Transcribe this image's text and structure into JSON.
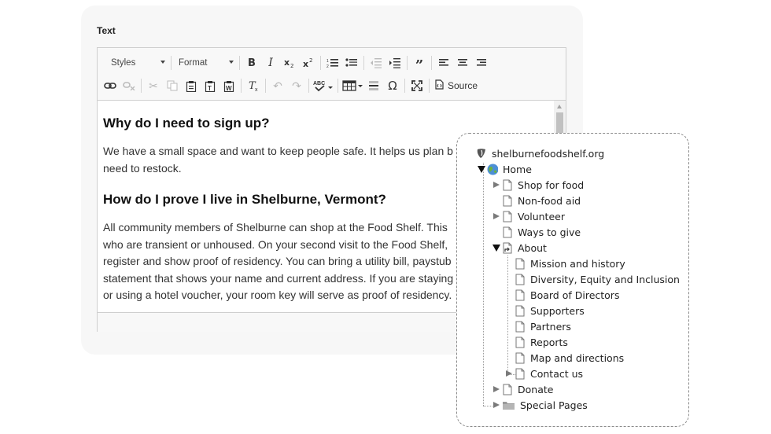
{
  "field": {
    "label": "Text"
  },
  "toolbar": {
    "styles_label": "Styles",
    "format_label": "Format",
    "source_label": "Source"
  },
  "content": {
    "heading1": "Why do I need to sign up?",
    "para1_lines": [
      "We have a small space and want to keep people safe. It helps us plan b",
      "need to restock."
    ],
    "heading2": "How do I prove I live in Shelburne, Vermont?",
    "para2_lines": [
      "All community members of Shelburne can shop at the Food Shelf. This",
      "who are transient or unhoused. On your second visit to the Food Shelf,",
      "register and show proof of residency. You can bring a utility bill, paystub",
      "statement that shows your name and current address. If you are staying",
      "or using a hotel voucher, your room key will serve as proof of residency."
    ]
  },
  "tree": {
    "root": "shelburnefoodshelf.org",
    "home": "Home",
    "items": [
      "Shop for food",
      "Non-food aid",
      "Volunteer",
      "Ways to give",
      "About",
      "Mission and history",
      "Diversity, Equity and Inclusion",
      "Board of Directors",
      "Supporters",
      "Partners",
      "Reports",
      "Map and directions",
      "Contact us",
      "Donate",
      "Special Pages"
    ]
  },
  "colors": {
    "globe": "#4c8fd6",
    "globe_land": "#6cb33f",
    "typo3_logo": "#555555"
  }
}
